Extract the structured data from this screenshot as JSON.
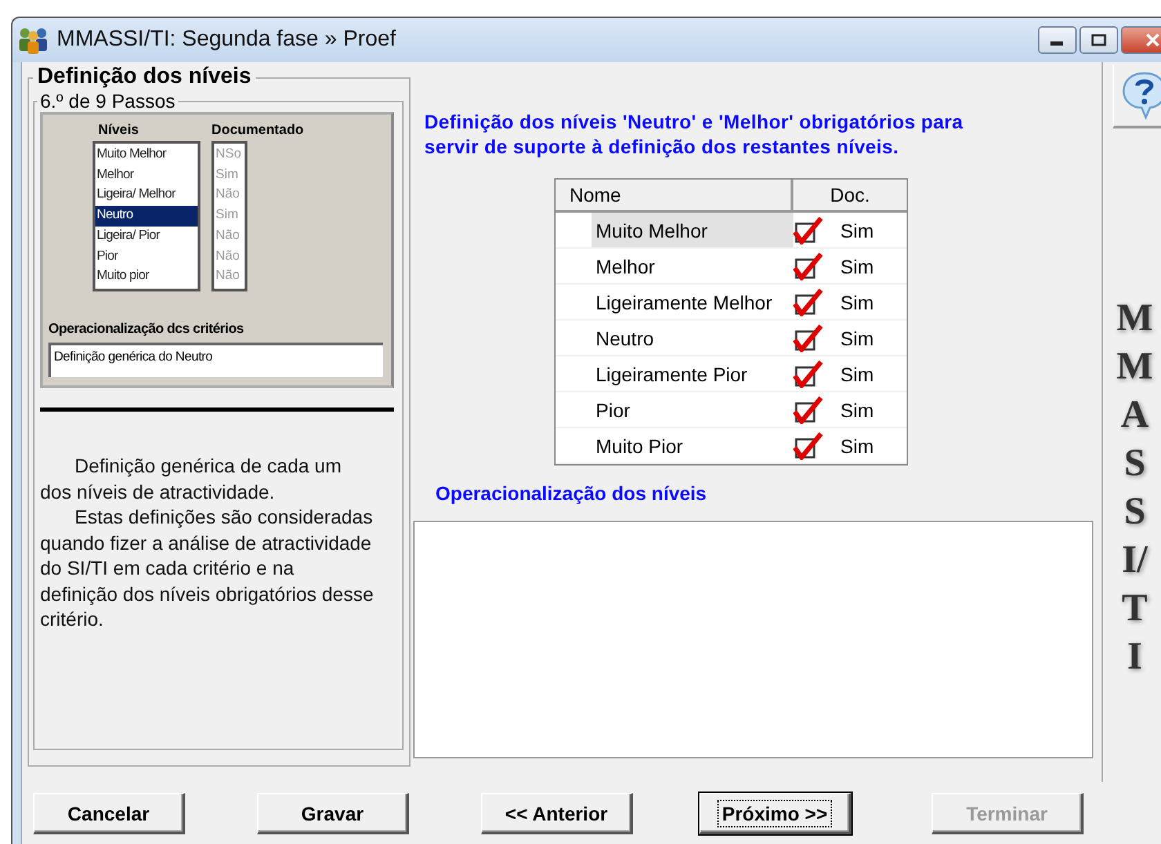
{
  "window": {
    "title": "MMASSI/TI: Segunda fase  »  Proef"
  },
  "group_title": "Definição dos níveis",
  "step_label": "6.º de 9 Passos",
  "preview": {
    "headers": [
      "Níveis",
      "Documentado"
    ],
    "items": [
      {
        "name": "Muito Melhor",
        "doc": "NSo",
        "selected": false
      },
      {
        "name": "Melhor",
        "doc": "Sim",
        "selected": false
      },
      {
        "name": "Ligeira/ Melhor",
        "doc": "Não",
        "selected": false
      },
      {
        "name": "Neutro",
        "doc": "Sim",
        "selected": true
      },
      {
        "name": "Ligeira/ Pior",
        "doc": "Não",
        "selected": false
      },
      {
        "name": "Pior",
        "doc": "Não",
        "selected": false
      },
      {
        "name": "Muito pior",
        "doc": "Não",
        "selected": false
      }
    ],
    "criteria_label": "Operacionalização dcs critérios",
    "criteria_value": "Definição genérica do Neutro"
  },
  "description": [
    "Definição genérica de cada um dos níveis de atractividade.",
    "Estas definições são consideradas quando fizer a análise de atractividade do SI/TI em cada critério e na definição dos níveis obrigatórios desse critério."
  ],
  "instruction": "Definição dos níveis 'Neutro' e 'Melhor' obrigatórios para servir de suporte à definição dos restantes níveis.",
  "table": {
    "columns": [
      "Nome",
      "Doc."
    ],
    "rows": [
      {
        "name": "Muito Melhor",
        "checked": true,
        "doc": "Sim",
        "selected": true
      },
      {
        "name": "Melhor",
        "checked": true,
        "doc": "Sim",
        "selected": false
      },
      {
        "name": "Ligeiramente Melhor",
        "checked": true,
        "doc": "Sim",
        "selected": false
      },
      {
        "name": "Neutro",
        "checked": true,
        "doc": "Sim",
        "selected": false
      },
      {
        "name": "Ligeiramente Pior",
        "checked": true,
        "doc": "Sim",
        "selected": false
      },
      {
        "name": "Pior",
        "checked": true,
        "doc": "Sim",
        "selected": false
      },
      {
        "name": "Muito Pior",
        "checked": true,
        "doc": "Sim",
        "selected": false
      }
    ]
  },
  "operationalization_label": "Operacionalização dos níveis",
  "side_logo": "MMASSI/TI",
  "buttons": [
    {
      "label": "Cancelar",
      "disabled": false,
      "focused": false
    },
    {
      "label": "Gravar",
      "disabled": false,
      "focused": false
    },
    {
      "label": "<< Anterior",
      "disabled": false,
      "focused": false
    },
    {
      "label": "Próximo >>",
      "disabled": false,
      "focused": true
    },
    {
      "label": "Terminar",
      "disabled": true,
      "focused": false
    }
  ]
}
